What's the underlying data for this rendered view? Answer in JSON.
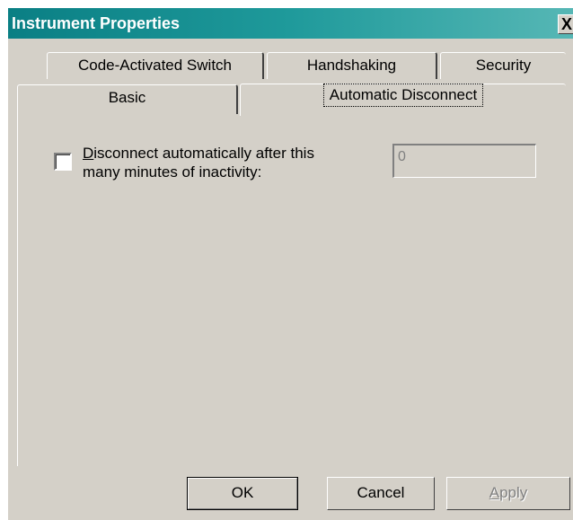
{
  "window": {
    "title": "Instrument Properties",
    "close_label": "X"
  },
  "tabs": {
    "row1": [
      {
        "label": "Code-Activated Switch"
      },
      {
        "label": "Handshaking"
      },
      {
        "label": "Security"
      }
    ],
    "row2": [
      {
        "label": "Basic"
      },
      {
        "label": "Automatic Disconnect",
        "selected": true
      }
    ]
  },
  "auto_disconnect": {
    "checkbox_checked": false,
    "checkbox_label_underlined": "D",
    "checkbox_label_rest1": "isconnect automatically after this",
    "checkbox_label_line2": "many minutes of inactivity:",
    "minutes_value": "0"
  },
  "buttons": {
    "ok": "OK",
    "cancel": "Cancel",
    "apply_underlined": "A",
    "apply_rest": "pply"
  }
}
